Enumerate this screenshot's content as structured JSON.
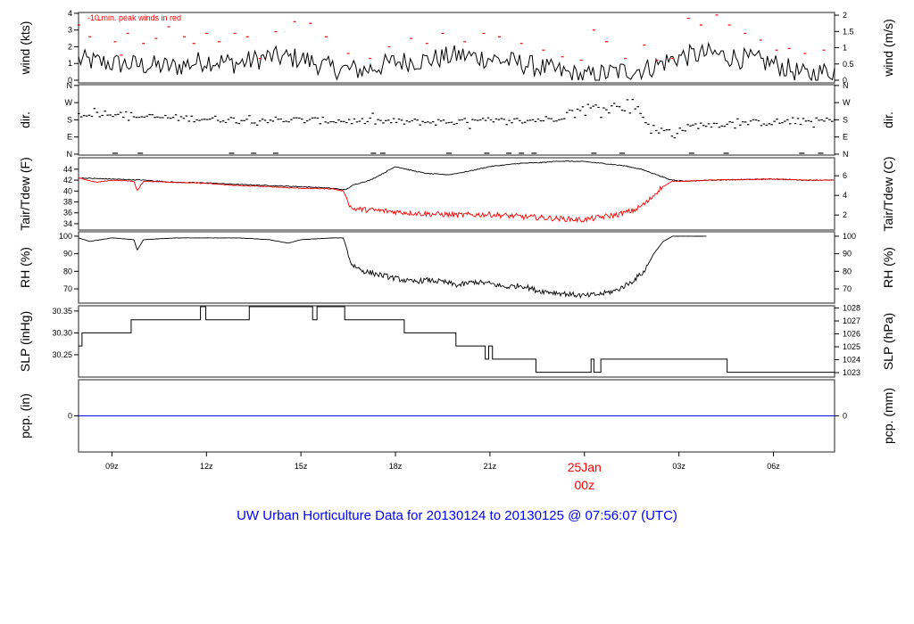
{
  "title": "UW Urban Horticulture Data for 20130124  to  20130125 @ 07:56:07  (UTC)",
  "colors": {
    "primary": "#000000",
    "peak": "#ff0000",
    "dew": "#ff0000",
    "zero_line": "#0000ff",
    "title": "#0000ff"
  },
  "x_axis": {
    "unit": "hour UTC from 20130124 00z",
    "xlim": [
      7.94,
      31.94
    ],
    "ticks": [
      {
        "hour": 9,
        "label": "09z"
      },
      {
        "hour": 12,
        "label": "12z"
      },
      {
        "hour": 15,
        "label": "15z"
      },
      {
        "hour": 18,
        "label": "18z"
      },
      {
        "hour": 21,
        "label": "21z"
      },
      {
        "hour": 24,
        "label": "00z",
        "date_label": "25Jan"
      },
      {
        "hour": 27,
        "label": "03z"
      },
      {
        "hour": 30,
        "label": "06z"
      }
    ]
  },
  "chart_data": [
    {
      "id": "wind",
      "type": "line",
      "ylabel": "wind (kts)",
      "ylabel_right": "wind (m/s)",
      "ylim": [
        -0.16,
        4.05
      ],
      "yticks": [
        "0",
        "1",
        "2",
        "3",
        "4"
      ],
      "yticks_right": [
        "0",
        "0.5",
        "1",
        "1.5",
        "2"
      ],
      "right_factor": 1.944,
      "annotation": "-10 min. peak winds in red",
      "series": [
        {
          "name": "wind speed",
          "hourly_mean": [
            [
              8,
              1.2
            ],
            [
              9,
              1.0
            ],
            [
              10,
              0.9
            ],
            [
              11,
              0.8
            ],
            [
              12,
              1.2
            ],
            [
              13,
              1.0
            ],
            [
              14,
              1.4
            ],
            [
              15,
              1.3
            ],
            [
              16,
              0.7
            ],
            [
              17,
              0.6
            ],
            [
              18,
              1.1
            ],
            [
              19,
              1.2
            ],
            [
              20,
              1.5
            ],
            [
              21,
              1.3
            ],
            [
              22,
              1.0
            ],
            [
              23,
              0.6
            ],
            [
              24,
              0.2
            ],
            [
              25,
              0.5
            ],
            [
              26,
              0.7
            ],
            [
              27,
              1.4
            ],
            [
              28,
              1.6
            ],
            [
              29,
              1.3
            ],
            [
              30,
              1.0
            ],
            [
              31,
              0.3
            ],
            [
              31.94,
              0.6
            ]
          ]
        },
        {
          "name": "10 min peak",
          "points": [
            [
              7.95,
              3.3
            ],
            [
              8.3,
              2.6
            ],
            [
              8.6,
              3.6
            ],
            [
              9.1,
              2.3
            ],
            [
              9.3,
              1.5
            ],
            [
              9.5,
              2.8
            ],
            [
              10.0,
              2.2
            ],
            [
              10.4,
              2.5
            ],
            [
              10.8,
              3.2
            ],
            [
              11.3,
              2.6
            ],
            [
              11.6,
              2.2
            ],
            [
              12.0,
              2.8
            ],
            [
              12.4,
              2.3
            ],
            [
              12.9,
              2.8
            ],
            [
              13.3,
              2.6
            ],
            [
              13.7,
              1.3
            ],
            [
              14.2,
              2.9
            ],
            [
              14.8,
              3.5
            ],
            [
              15.3,
              3.4
            ],
            [
              15.8,
              2.6
            ],
            [
              16.5,
              1.6
            ],
            [
              17.2,
              1.3
            ],
            [
              17.8,
              2.0
            ],
            [
              18.5,
              2.5
            ],
            [
              19.0,
              2.2
            ],
            [
              19.5,
              2.8
            ],
            [
              20.2,
              2.3
            ],
            [
              20.8,
              2.8
            ],
            [
              21.3,
              2.6
            ],
            [
              22.0,
              2.2
            ],
            [
              22.7,
              1.8
            ],
            [
              23.3,
              1.4
            ],
            [
              23.9,
              1.2
            ],
            [
              24.3,
              3.0
            ],
            [
              24.7,
              2.3
            ],
            [
              25.3,
              1.3
            ],
            [
              25.9,
              2.1
            ],
            [
              26.3,
              1.2
            ],
            [
              26.8,
              1.3
            ],
            [
              27.3,
              3.7
            ],
            [
              27.7,
              3.3
            ],
            [
              28.2,
              3.9
            ],
            [
              28.6,
              3.3
            ],
            [
              29.1,
              2.8
            ],
            [
              29.6,
              2.4
            ],
            [
              30.1,
              1.8
            ],
            [
              30.5,
              1.9
            ],
            [
              31.0,
              1.6
            ],
            [
              31.6,
              1.8
            ]
          ]
        }
      ]
    },
    {
      "id": "dir",
      "type": "scatter",
      "ylabel": "dir.",
      "ylabel_right": "dir.",
      "ylim": [
        -5,
        364
      ],
      "yticks": [
        "N",
        "E",
        "S",
        "W",
        "N"
      ],
      "ytick_values": [
        0,
        90,
        180,
        270,
        360
      ],
      "series": [
        {
          "name": "wind direction (deg)",
          "hourly_mean": [
            [
              8,
              210
            ],
            [
              9,
              215
            ],
            [
              10,
              195
            ],
            [
              11,
              190
            ],
            [
              12,
              185
            ],
            [
              13,
              180
            ],
            [
              14,
              180
            ],
            [
              15,
              178
            ],
            [
              16,
              175
            ],
            [
              17,
              172
            ],
            [
              18,
              170
            ],
            [
              19,
              168
            ],
            [
              20,
              170
            ],
            [
              21,
              172
            ],
            [
              22,
              175
            ],
            [
              23,
              185
            ],
            [
              24,
              235
            ],
            [
              25,
              250
            ],
            [
              25.6,
              260
            ],
            [
              26.2,
              120
            ],
            [
              26.8,
              115
            ],
            [
              27.5,
              150
            ],
            [
              28.5,
              160
            ],
            [
              29.5,
              165
            ],
            [
              30.5,
              170
            ],
            [
              31.94,
              175
            ]
          ]
        },
        {
          "name": "calm (N)",
          "hours": [
            9.1,
            9.9,
            12.8,
            13.5,
            14.2,
            17.3,
            17.6,
            19.7,
            20.9,
            21.6,
            22.0,
            22.4,
            24.3,
            25.2,
            27.4,
            28.5,
            30.9,
            31.5
          ]
        }
      ]
    },
    {
      "id": "temp",
      "type": "line",
      "ylabel": "Tair/Tdew (F)",
      "ylabel_right": "Tair/Tdew (C)",
      "ylim": [
        32.85,
        46.1
      ],
      "yticks": [
        "34",
        "36",
        "38",
        "40",
        "42",
        "44"
      ],
      "yticks_right": [
        "2",
        "4",
        "6"
      ],
      "series": [
        {
          "name": "Tair",
          "points": [
            [
              7.94,
              42.4
            ],
            [
              9,
              42.2
            ],
            [
              10,
              42.0
            ],
            [
              11,
              41.6
            ],
            [
              12,
              41.5
            ],
            [
              13,
              41.2
            ],
            [
              14,
              41.0
            ],
            [
              15,
              40.8
            ],
            [
              16,
              40.5
            ],
            [
              16.4,
              40.2
            ],
            [
              16.7,
              41.2
            ],
            [
              17.2,
              42.0
            ],
            [
              17.6,
              43.2
            ],
            [
              18.0,
              44.5
            ],
            [
              18.5,
              43.8
            ],
            [
              19.0,
              43.2
            ],
            [
              19.7,
              43.0
            ],
            [
              20.3,
              43.6
            ],
            [
              21.0,
              44.5
            ],
            [
              21.5,
              44.8
            ],
            [
              22.0,
              45.1
            ],
            [
              22.6,
              45.2
            ],
            [
              23.2,
              45.5
            ],
            [
              24.0,
              45.4
            ],
            [
              24.7,
              45.0
            ],
            [
              25.3,
              44.6
            ],
            [
              25.8,
              44.0
            ],
            [
              26.3,
              43.0
            ],
            [
              26.7,
              42.1
            ],
            [
              27.2,
              41.8
            ],
            [
              28,
              42.0
            ],
            [
              29,
              42.1
            ],
            [
              30,
              42.2
            ],
            [
              31,
              42.0
            ],
            [
              31.94,
              42.0
            ]
          ]
        },
        {
          "name": "Tdew",
          "points": [
            [
              7.94,
              42.4
            ],
            [
              8.5,
              41.6
            ],
            [
              9,
              42.0
            ],
            [
              9.7,
              41.8
            ],
            [
              9.8,
              40.0
            ],
            [
              10,
              41.8
            ],
            [
              11,
              41.6
            ],
            [
              12,
              41.4
            ],
            [
              13,
              41.0
            ],
            [
              14,
              40.8
            ],
            [
              15,
              40.5
            ],
            [
              16,
              40.4
            ],
            [
              16.35,
              40.0
            ],
            [
              16.6,
              36.8
            ],
            [
              17,
              36.6
            ],
            [
              18,
              36.2
            ],
            [
              19,
              35.8
            ],
            [
              20,
              35.6
            ],
            [
              21,
              35.7
            ],
            [
              22,
              35.3
            ],
            [
              23,
              35.0
            ],
            [
              24,
              34.7
            ],
            [
              24.5,
              35.2
            ],
            [
              25,
              35.6
            ],
            [
              25.6,
              36.5
            ],
            [
              26.0,
              38.0
            ],
            [
              26.4,
              40.5
            ],
            [
              26.8,
              41.8
            ],
            [
              27.2,
              41.8
            ],
            [
              28,
              42.0
            ],
            [
              29,
              42.1
            ],
            [
              30,
              42.2
            ],
            [
              31,
              42.0
            ],
            [
              31.94,
              42.0
            ]
          ]
        }
      ]
    },
    {
      "id": "rh",
      "type": "line",
      "ylabel": "RH (%)",
      "ylabel_right": "RH (%)",
      "ylim": [
        61.9,
        102.5
      ],
      "yticks": [
        "70",
        "80",
        "90",
        "100"
      ],
      "yticks_right": [
        "70",
        "80",
        "90",
        "100"
      ],
      "series": [
        {
          "name": "RH",
          "points": [
            [
              7.94,
              99
            ],
            [
              8.3,
              97
            ],
            [
              9,
              99
            ],
            [
              9.7,
              98
            ],
            [
              9.8,
              92
            ],
            [
              10,
              98
            ],
            [
              11,
              99
            ],
            [
              12,
              99
            ],
            [
              13,
              99
            ],
            [
              14,
              98
            ],
            [
              14.6,
              96
            ],
            [
              15,
              98
            ],
            [
              16,
              99
            ],
            [
              16.35,
              99
            ],
            [
              16.6,
              84
            ],
            [
              17,
              80
            ],
            [
              17.5,
              78
            ],
            [
              18,
              76
            ],
            [
              18.5,
              74
            ],
            [
              19,
              75
            ],
            [
              19.5,
              74
            ],
            [
              20,
              72
            ],
            [
              20.5,
              74
            ],
            [
              21,
              73
            ],
            [
              21.5,
              71
            ],
            [
              22,
              72
            ],
            [
              22.5,
              69
            ],
            [
              23,
              68
            ],
            [
              23.5,
              67
            ],
            [
              24,
              66
            ],
            [
              24.5,
              67
            ],
            [
              25,
              69
            ],
            [
              25.5,
              74
            ],
            [
              25.9,
              80
            ],
            [
              26.2,
              90
            ],
            [
              26.5,
              97
            ],
            [
              26.8,
              100
            ],
            [
              27.9,
              100
            ]
          ]
        }
      ]
    },
    {
      "id": "slp",
      "type": "step",
      "ylabel": "SLP (inHg)",
      "ylabel_right": "SLP (hPa)",
      "ylim": [
        30.199,
        30.362
      ],
      "yticks": [
        "30.25",
        "30.30",
        "30.35"
      ],
      "yticks_right": [
        "1023",
        "1024",
        "1025",
        "1026",
        "1027",
        "1028"
      ],
      "series": [
        {
          "name": "SLP",
          "steps": [
            [
              7.94,
              30.27
            ],
            [
              8.05,
              30.3
            ],
            [
              9.61,
              30.33
            ],
            [
              11.81,
              30.36
            ],
            [
              11.98,
              30.33
            ],
            [
              13.36,
              30.36
            ],
            [
              15.37,
              30.33
            ],
            [
              15.51,
              30.36
            ],
            [
              16.39,
              30.33
            ],
            [
              18.28,
              30.3
            ],
            [
              19.92,
              30.27
            ],
            [
              20.85,
              30.24
            ],
            [
              20.96,
              30.27
            ],
            [
              21.08,
              30.24
            ],
            [
              22.46,
              30.21
            ],
            [
              24.21,
              30.24
            ],
            [
              24.3,
              30.21
            ],
            [
              24.52,
              30.24
            ],
            [
              28.53,
              30.21
            ],
            [
              31.94,
              30.21
            ]
          ]
        }
      ]
    },
    {
      "id": "pcp",
      "type": "line",
      "ylabel": "pcp. (in)",
      "ylabel_right": "pcp. (mm)",
      "ylim": [
        -1,
        1
      ],
      "yticks": [
        "0"
      ],
      "yticks_right": [
        "0"
      ],
      "series": [
        {
          "name": "precip",
          "points": [
            [
              7.94,
              0
            ],
            [
              31.94,
              0
            ]
          ]
        }
      ]
    }
  ]
}
